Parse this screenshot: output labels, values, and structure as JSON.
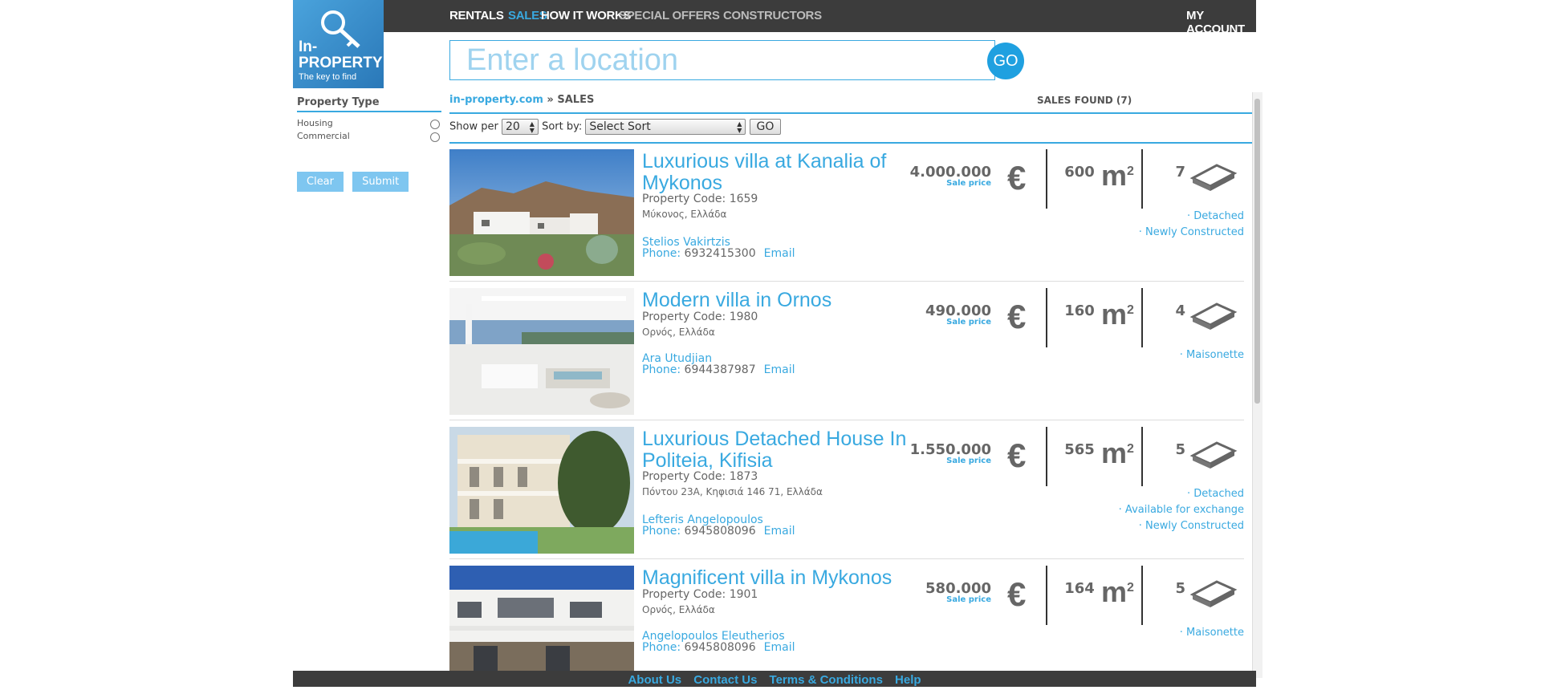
{
  "logo": {
    "line1": "In-",
    "line2": "PROPERTY",
    "tagline": "The key to find"
  },
  "nav": {
    "rentals": "RENTALS",
    "sales": "SALES",
    "how_it_works": "HOW IT WORKS",
    "special_offers": "SPECIAL OFFERS",
    "constructors": "CONSTRUCTORS",
    "my_account": "MY ACCOUNT"
  },
  "search": {
    "placeholder": "Enter a location",
    "go": "GO"
  },
  "sidebar": {
    "title": "Property Type",
    "options": [
      "Housing",
      "Commercial"
    ],
    "clear": "Clear",
    "submit": "Submit"
  },
  "breadcrumb": {
    "site": "in-property.com",
    "sep": " » ",
    "page": "SALES"
  },
  "results": {
    "found": "SALES FOUND (7)"
  },
  "sortbar": {
    "show_per_label": "Show per",
    "show_per_value": "20",
    "sort_by_label": "Sort by:",
    "sort_value": "Select Sort",
    "go": "GO"
  },
  "listings": [
    {
      "title": "Luxurious villa at Kanalia of Mykonos",
      "code": "Property Code: 1659",
      "location": "Μύκονος, Ελλάδα",
      "agent": "Stelios Vakirtzis",
      "phone_label": "Phone:",
      "phone": "6932415300",
      "email": "Email",
      "price": "4.000.000",
      "price_label": "Sale price",
      "area": "600",
      "rooms": "7",
      "tags": [
        "· Detached",
        "· Newly Constructed"
      ]
    },
    {
      "title": "Modern villa in Ornos",
      "code": "Property Code: 1980",
      "location": "Ορνός, Ελλάδα",
      "agent": "Ara Utudjian",
      "phone_label": "Phone:",
      "phone": "6944387987",
      "email": "Email",
      "price": "490.000",
      "price_label": "Sale price",
      "area": "160",
      "rooms": "4",
      "tags": [
        "· Maisonette"
      ]
    },
    {
      "title": "Luxurious Detached House In Politeia, Kifisia",
      "code": "Property Code: 1873",
      "location": "Πόντου 23Α, Κηφισιά 146 71, Ελλάδα",
      "agent": "Lefteris Angelopoulos",
      "phone_label": "Phone:",
      "phone": "6945808096",
      "email": "Email",
      "price": "1.550.000",
      "price_label": "Sale price",
      "area": "565",
      "rooms": "5",
      "tags": [
        "· Detached",
        "· Available for exchange",
        "· Newly Constructed"
      ]
    },
    {
      "title": "Magnificent villa in Mykonos",
      "code": "Property Code: 1901",
      "location": "Ορνός, Ελλάδα",
      "agent": "Angelopoulos Eleutherios",
      "phone_label": "Phone:",
      "phone": "6945808096",
      "email": "Email",
      "price": "580.000",
      "price_label": "Sale price",
      "area": "164",
      "rooms": "5",
      "tags": [
        "· Maisonette"
      ]
    }
  ],
  "units": {
    "currency": "€",
    "area": "m",
    "area_sup": "2"
  },
  "footer": {
    "about": "About Us",
    "contact": "Contact Us",
    "terms": "Terms & Conditions",
    "help": "Help"
  },
  "colors": {
    "accent": "#39a9e0",
    "nav_bg": "#3c3c3c",
    "text": "#555555"
  }
}
